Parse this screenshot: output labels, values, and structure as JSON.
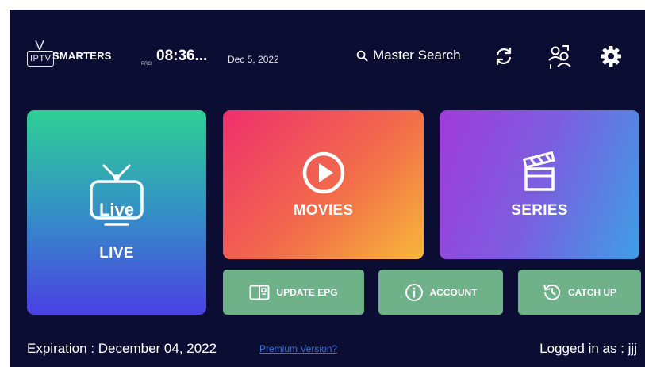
{
  "header": {
    "logo_box": "IPTV",
    "logo_word": "SMARTERS",
    "logo_sub": "PRO",
    "time": "08:36...",
    "date": "Dec 5, 2022",
    "search_label": "Master Search"
  },
  "tiles": {
    "live_badge": "Live",
    "live_label": "LIVE",
    "movies_label": "MOVIES",
    "series_label": "SERIES"
  },
  "buttons": {
    "update_epg": "UPDATE EPG",
    "account": "ACCOUNT",
    "catch_up": "CATCH UP"
  },
  "footer": {
    "expiration": "Expiration : December 04, 2022",
    "premium_link": "Premium Version?",
    "logged_in": "Logged in as : jjj"
  },
  "colors": {
    "background": "#0b0d33",
    "button_green": "#6fb28a",
    "link_blue": "#3a73d6"
  },
  "icons": [
    "tv-antenna-logo",
    "search-icon",
    "refresh-icon",
    "switch-user-icon",
    "gear-icon",
    "live-tv-icon",
    "play-circle-icon",
    "clapperboard-icon",
    "book-icon",
    "info-icon",
    "history-icon"
  ]
}
